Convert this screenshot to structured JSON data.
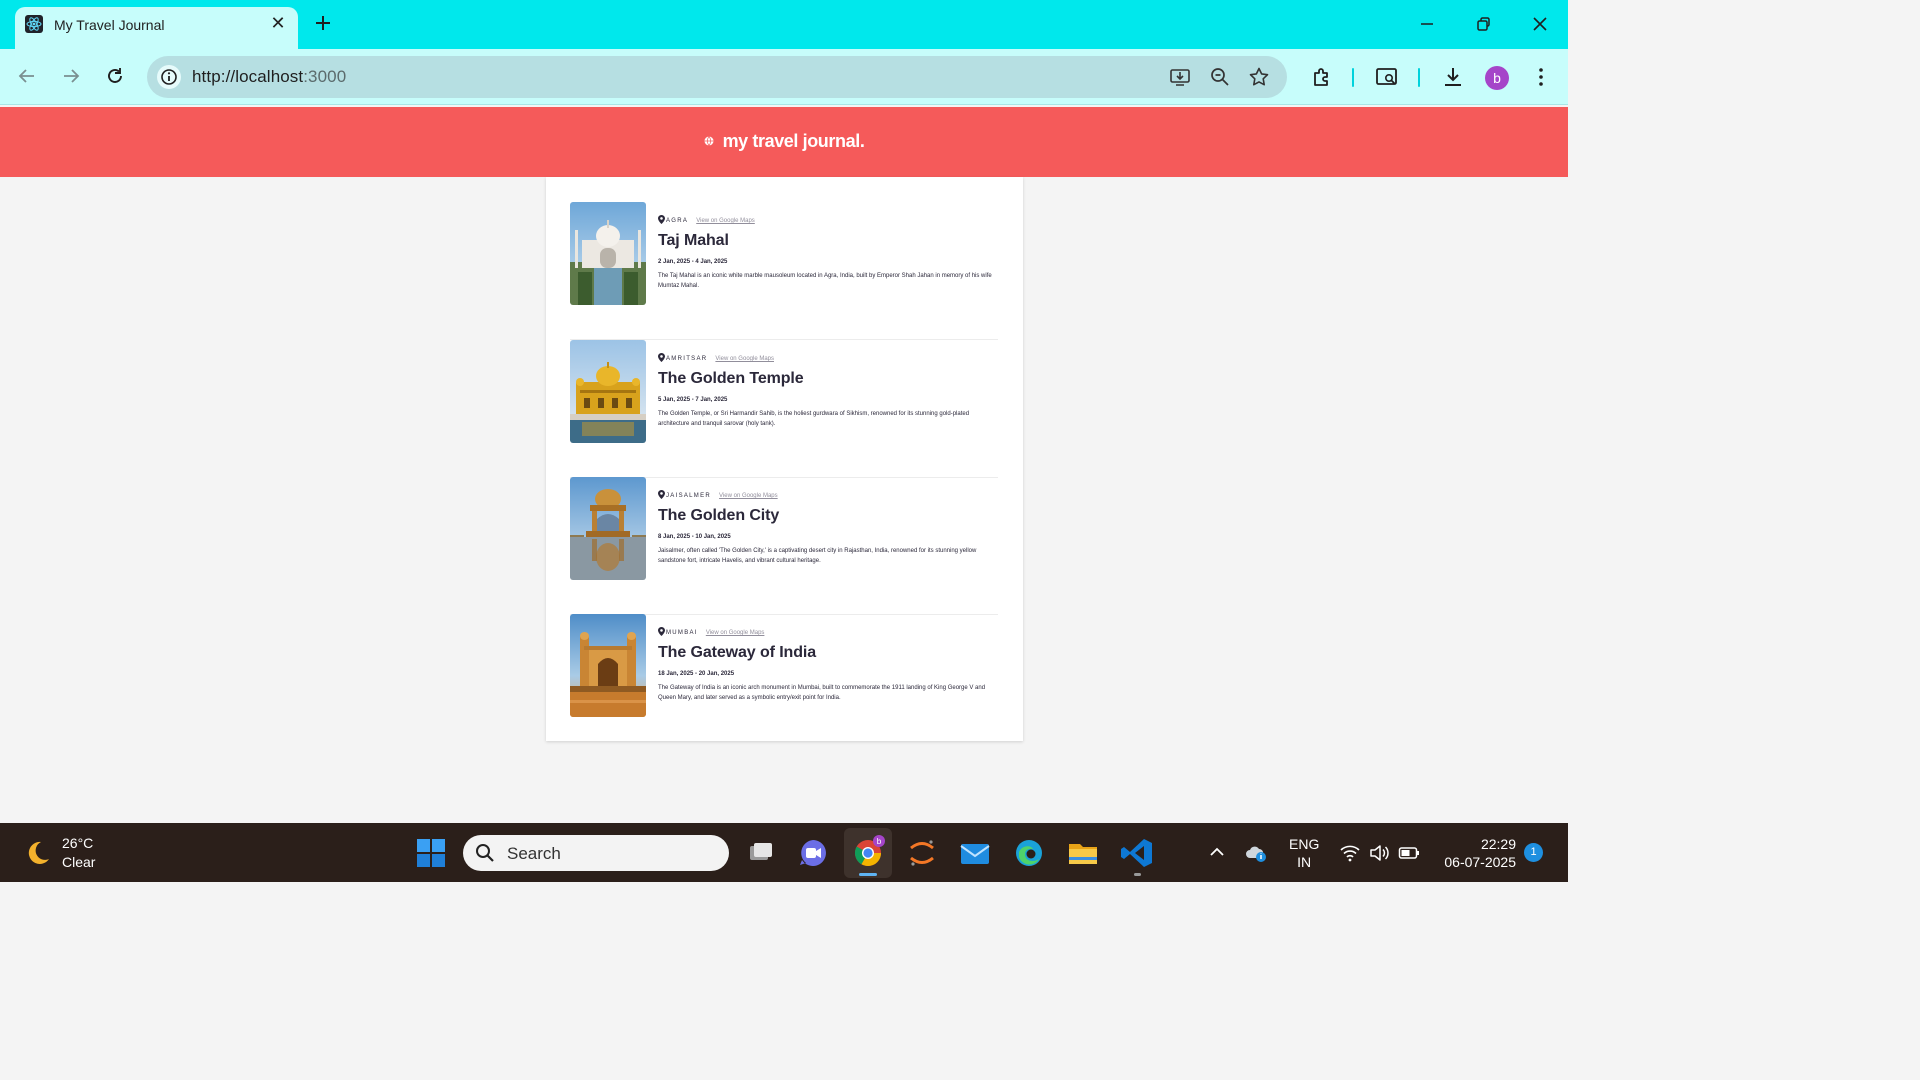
{
  "browser": {
    "tab_title": "My Travel Journal",
    "tab_close": "✕",
    "url_host": "http://localhost",
    "url_port": ":3000",
    "profile_initial": "b",
    "accent_color": "#00e8ec"
  },
  "header": {
    "brand": "my travel journal.",
    "background_color": "#f55a5a"
  },
  "entries": [
    {
      "location": "AGRA",
      "maps_link": "View on Google Maps",
      "title": "Taj Mahal",
      "dates": "2 Jan, 2025 - 4 Jan, 2025",
      "description": "The Taj Mahal is an iconic white marble mausoleum located in Agra, India, built by Emperor Shah Jahan in memory of his wife Mumtaz Mahal."
    },
    {
      "location": "AMRITSAR",
      "maps_link": "View on Google Maps",
      "title": "The Golden Temple",
      "dates": "5 Jan, 2025 - 7 Jan, 2025",
      "description": "The Golden Temple, or Sri Harmandir Sahib, is the holiest gurdwara of Sikhism, renowned for its stunning gold-plated architecture and tranquil sarovar (holy tank)."
    },
    {
      "location": "JAISALMER",
      "maps_link": "View on Google Maps",
      "title": "The Golden City",
      "dates": "8 Jan, 2025 - 10 Jan, 2025",
      "description": "Jaisalmer, often called 'The Golden City,' is a captivating desert city in Rajasthan, India, renowned for its stunning yellow sandstone fort, intricate Havelis, and vibrant cultural heritage."
    },
    {
      "location": "MUMBAI",
      "maps_link": "View on Google Maps",
      "title": "The Gateway of India",
      "dates": "18 Jan, 2025 - 20 Jan, 2025",
      "description": "The Gateway of India is an iconic arch monument in Mumbai, built to commemorate the 1911 landing of King George V and Queen Mary, and later served as a symbolic entry/exit point for India."
    }
  ],
  "taskbar": {
    "weather_temp": "26°C",
    "weather_condition": "Clear",
    "search_placeholder": "Search",
    "language_line1": "ENG",
    "language_line2": "IN",
    "time": "22:29",
    "date": "06-07-2025",
    "notification_count": "1"
  }
}
